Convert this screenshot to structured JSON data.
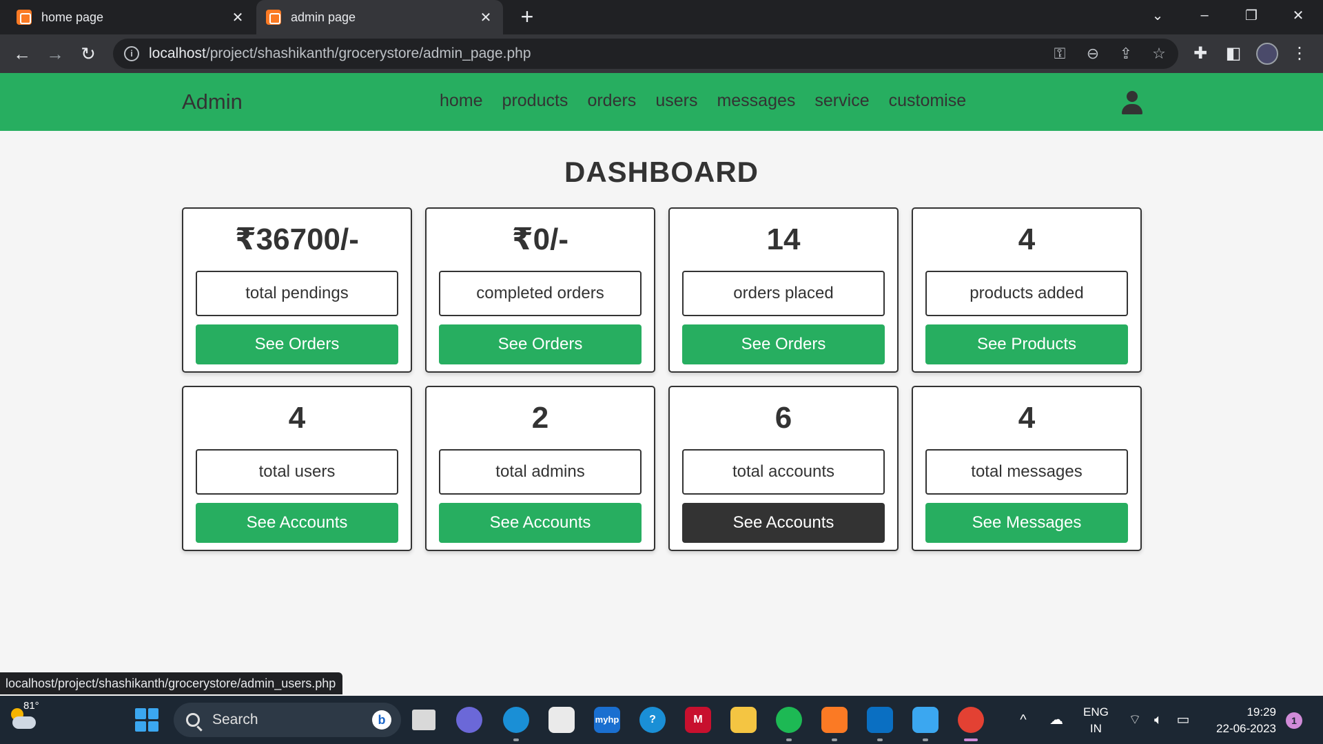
{
  "browser": {
    "tabs": [
      {
        "title": "home page",
        "active": false
      },
      {
        "title": "admin page",
        "active": true
      }
    ],
    "new_tab_icon": "plus-icon",
    "address": {
      "host": "localhost",
      "path": "/project/shashikanth/grocerystore/admin_page.php"
    },
    "status_url": "localhost/project/shashikanth/grocerystore/admin_users.php"
  },
  "header": {
    "brand": "Admin",
    "nav": [
      "home",
      "products",
      "orders",
      "users",
      "messages",
      "service",
      "customise"
    ],
    "accent_color": "#27ae60"
  },
  "dashboard": {
    "title": "DASHBOARD",
    "cards": [
      {
        "value": "₹36700/-",
        "label": "total pendings",
        "button": "See Orders",
        "style": "green"
      },
      {
        "value": "₹0/-",
        "label": "completed orders",
        "button": "See Orders",
        "style": "green"
      },
      {
        "value": "14",
        "label": "orders placed",
        "button": "See Orders",
        "style": "green"
      },
      {
        "value": "4",
        "label": "products added",
        "button": "See Products",
        "style": "green"
      },
      {
        "value": "4",
        "label": "total users",
        "button": "See Accounts",
        "style": "green"
      },
      {
        "value": "2",
        "label": "total admins",
        "button": "See Accounts",
        "style": "green"
      },
      {
        "value": "6",
        "label": "total accounts",
        "button": "See Accounts",
        "style": "dark"
      },
      {
        "value": "4",
        "label": "total messages",
        "button": "See Messages",
        "style": "green"
      }
    ]
  },
  "taskbar": {
    "weather_temp": "81°",
    "search_placeholder": "Search",
    "language": {
      "line1": "ENG",
      "line2": "IN"
    },
    "time": "19:29",
    "date": "22-06-2023",
    "notification_count": "1"
  }
}
